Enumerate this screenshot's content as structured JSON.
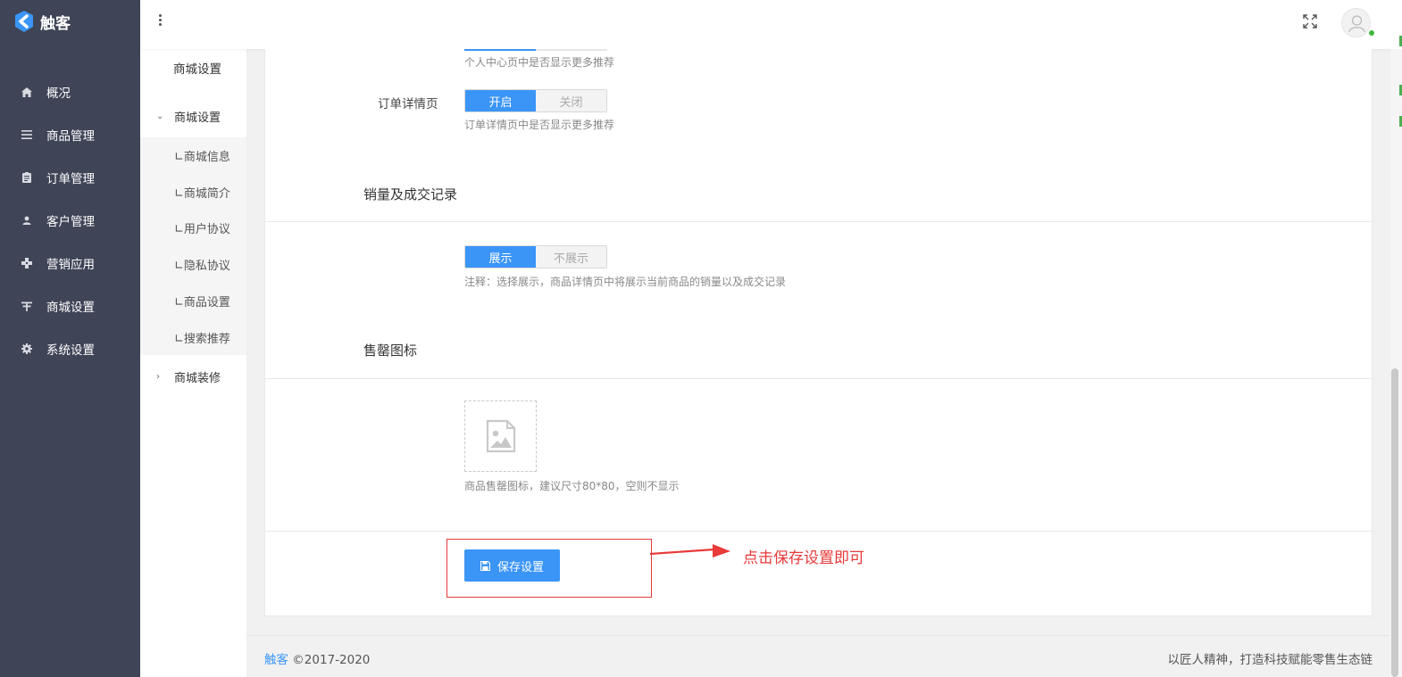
{
  "app": {
    "name": "触客"
  },
  "sidebar": {
    "items": [
      {
        "label": "概况",
        "icon": "home-icon"
      },
      {
        "label": "商品管理",
        "icon": "list-icon"
      },
      {
        "label": "订单管理",
        "icon": "clipboard-icon"
      },
      {
        "label": "客户管理",
        "icon": "user-icon"
      },
      {
        "label": "营销应用",
        "icon": "gamepad-icon"
      },
      {
        "label": "商城设置",
        "icon": "store-icon"
      },
      {
        "label": "系统设置",
        "icon": "gear-icon"
      }
    ]
  },
  "submenu": {
    "title": "商城设置",
    "group_open": "商城设置",
    "leaves": [
      "∟商城信息",
      "∟商城简介",
      "∟用户协议",
      "∟隐私协议",
      "∟商品设置",
      "∟搜索推荐"
    ],
    "group_closed": "商城装修"
  },
  "content": {
    "personal_center_hint": "个人中心页中是否显示更多推荐",
    "order_detail": {
      "label": "订单详情页",
      "on": "开启",
      "off": "关闭",
      "hint": "订单详情页中是否显示更多推荐"
    },
    "sales_section": {
      "title": "销量及成交记录",
      "on": "展示",
      "off": "不展示",
      "hint": "注释：选择展示，商品详情页中将展示当前商品的销量以及成交记录"
    },
    "soldout_section": {
      "title": "售罄图标",
      "hint": "商品售罄图标，建议尺寸80*80，空则不显示"
    },
    "save_label": "保存设置",
    "annotation": "点击保存设置即可"
  },
  "footer": {
    "brand": "触客",
    "copyright": "©2017-2020",
    "slogan": "以匠人精神，打造科技赋能零售生态链"
  },
  "colors": {
    "primary": "#3b95f7",
    "sidebar_bg": "#3f4457",
    "annotation_red": "#e83a3a"
  }
}
